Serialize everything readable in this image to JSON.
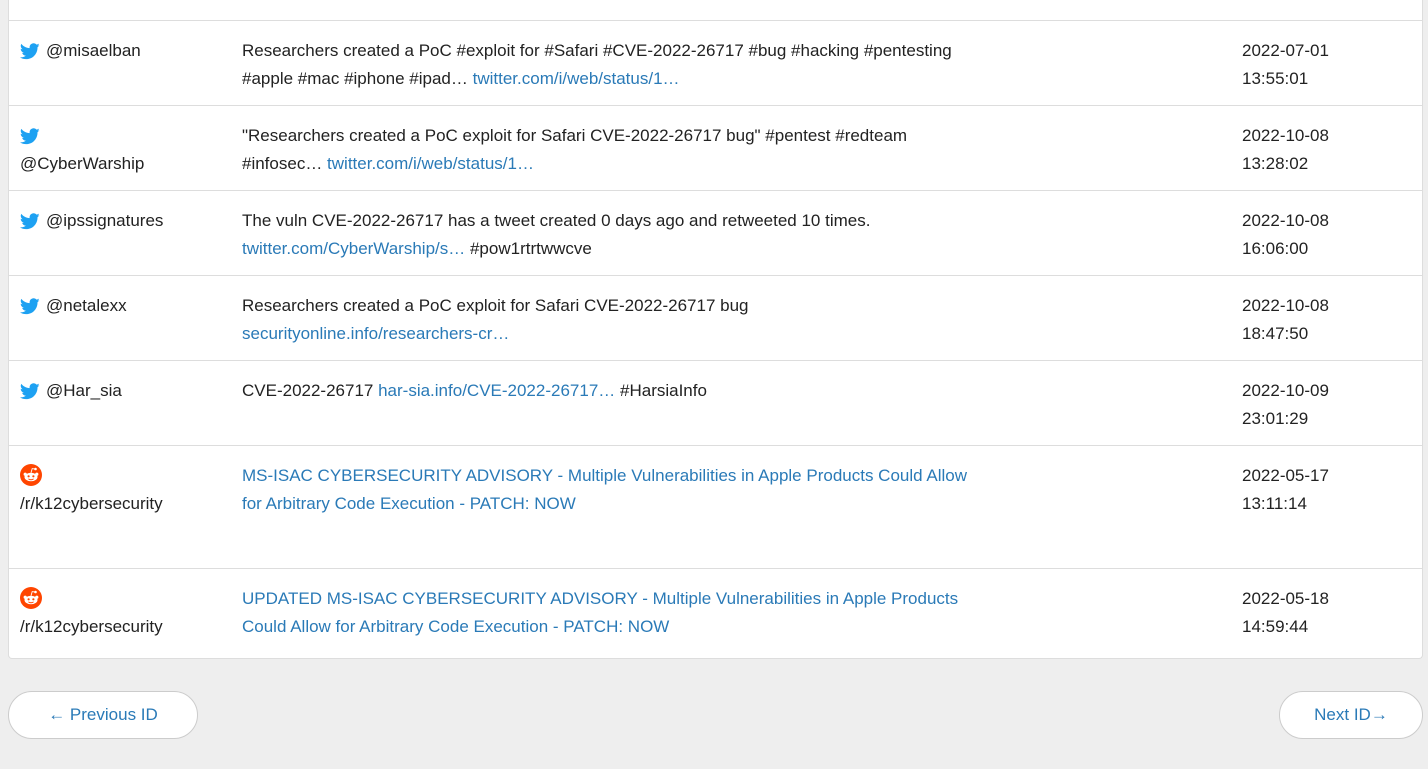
{
  "rows": [
    {
      "source": "twitter",
      "user": "@misaelban",
      "parts": [
        {
          "t": "Researchers created a PoC #exploit for #Safari #CVE-2022-26717 #bug #hacking #pentesting",
          "br": true
        },
        {
          "t": "#apple #mac #iphone #ipad… "
        },
        {
          "t": "twitter.com/i/web/status/1…",
          "link": true
        }
      ],
      "date": "2022-07-01",
      "time": "13:55:01"
    },
    {
      "source": "twitter",
      "user": "@CyberWarship",
      "user_break": true,
      "parts": [
        {
          "t": "\"Researchers created a PoC exploit for Safari CVE-2022-26717 bug\" #pentest #redteam",
          "br": true
        },
        {
          "t": "#infosec… "
        },
        {
          "t": "twitter.com/i/web/status/1…",
          "link": true
        }
      ],
      "date": "2022-10-08",
      "time": "13:28:02"
    },
    {
      "source": "twitter",
      "user": "@ipssignatures",
      "parts": [
        {
          "t": "The vuln CVE-2022-26717 has a tweet created 0 days ago and retweeted 10 times.",
          "br": true
        },
        {
          "t": "twitter.com/CyberWarship/s…",
          "link": true
        },
        {
          "t": " #pow1rtrtwwcve"
        }
      ],
      "date": "2022-10-08",
      "time": "16:06:00"
    },
    {
      "source": "twitter",
      "user": "@netalexx",
      "parts": [
        {
          "t": "Researchers created a PoC exploit for Safari CVE-2022-26717 bug",
          "br": true
        },
        {
          "t": "securityonline.info/researchers-cr…",
          "link": true
        }
      ],
      "date": "2022-10-08",
      "time": "18:47:50"
    },
    {
      "source": "twitter",
      "user": "@Har_sia",
      "parts": [
        {
          "t": "CVE-2022-26717 "
        },
        {
          "t": "har-sia.info/CVE-2022-26717…",
          "link": true
        },
        {
          "t": " #HarsiaInfo"
        }
      ],
      "date": "2022-10-09",
      "time": "23:01:29"
    },
    {
      "source": "reddit",
      "user": "/r/k12cybersecurity",
      "user_break": true,
      "parts": [
        {
          "t": "MS-ISAC CYBERSECURITY ADVISORY - Multiple Vulnerabilities in Apple Products Could Allow",
          "link": true,
          "br": true
        },
        {
          "t": "for Arbitrary Code Execution - PATCH: NOW",
          "link": true
        }
      ],
      "date": "2022-05-17",
      "time": "13:11:14"
    },
    {
      "source": "reddit",
      "user": "/r/k12cybersecurity",
      "user_break": true,
      "parts": [
        {
          "t": "UPDATED MS-ISAC CYBERSECURITY ADVISORY - Multiple Vulnerabilities in Apple Products",
          "link": true,
          "br": true
        },
        {
          "t": "Could Allow for Arbitrary Code Execution - PATCH: NOW",
          "link": true
        }
      ],
      "date": "2022-05-18",
      "time": "14:59:44"
    }
  ],
  "pager": {
    "prev_label": "← Previous ID",
    "next_label": "Next ID→"
  },
  "colors": {
    "link": "#2a7ab7",
    "twitter": "#1da1f2",
    "reddit": "#ff4500"
  }
}
